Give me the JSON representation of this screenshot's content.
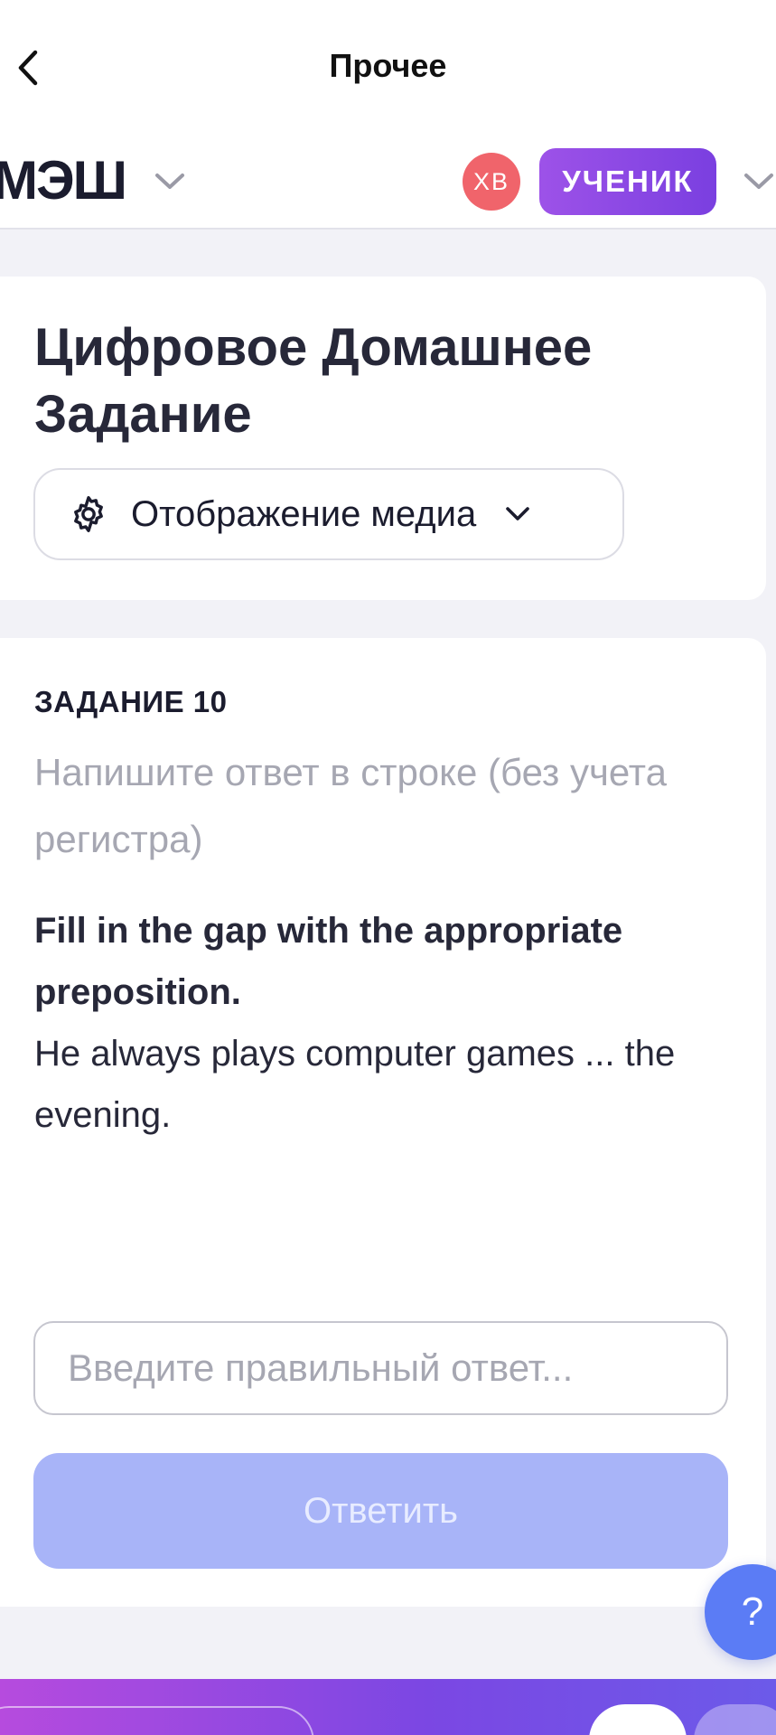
{
  "nav": {
    "title": "Прочее"
  },
  "header": {
    "brand": "МЭШ",
    "avatar_initials": "ХВ",
    "role": "УЧЕНИК"
  },
  "homework": {
    "title": "Цифровое Домашнее Задание",
    "media_label": "Отображение медиа"
  },
  "task": {
    "number": "ЗАДАНИЕ 10",
    "hint": "Напишите ответ в строке (без учета регистра)",
    "instruction": "Fill in the gap with the appropriate preposition.",
    "sentence": "He always plays computer games ... the evening.",
    "input_placeholder": "Введите правильный ответ...",
    "input_value": "",
    "submit_label": "Ответить"
  },
  "help": {
    "label": "?"
  },
  "colors": {
    "accent_purple": "#8a46e4",
    "avatar_red": "#f0646b",
    "submit_disabled": "#a8b4f8",
    "help_blue": "#5b7cf5"
  },
  "icons": [
    "back-arrow-icon",
    "chevron-down-icon",
    "gear-icon"
  ]
}
